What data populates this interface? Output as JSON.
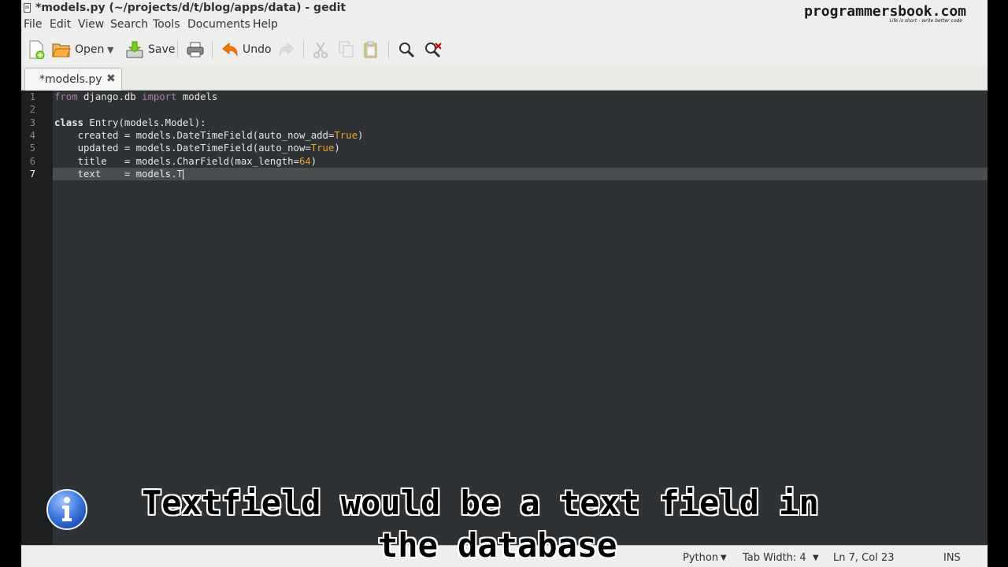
{
  "window": {
    "title": "*models.py (~/projects/d/t/blog/apps/data) - gedit"
  },
  "brand": {
    "name": "programmersbook.com",
    "tagline": "Life is short - write better code"
  },
  "menu": [
    "File",
    "Edit",
    "View",
    "Search",
    "Tools",
    "Documents",
    "Help"
  ],
  "toolbar": {
    "open_label": "Open",
    "save_label": "Save",
    "undo_label": "Undo"
  },
  "tab": {
    "label": "*models.py"
  },
  "editor": {
    "line_numbers": [
      "1",
      "2",
      "3",
      "4",
      "5",
      "6",
      "7"
    ],
    "lines": [
      "from django.db import models",
      "",
      "class Entry(models.Model):",
      "    created = models.DateTimeField(auto_now_add=True)",
      "    updated = models.DateTimeField(auto_now=True)",
      "    title   = models.CharField(max_length=64)",
      "    text    = models.T"
    ]
  },
  "status": {
    "language": "Python",
    "tab_width": "Tab Width: 4",
    "position": "Ln 7, Col 23",
    "mode": "INS"
  },
  "subtitle": {
    "line1": "Textfield would be a text field in",
    "line2": "the database"
  },
  "colors": {
    "editor_bg": "#2f3234",
    "keyword_import": "#ad7fa8",
    "literal": "#f0a030"
  }
}
